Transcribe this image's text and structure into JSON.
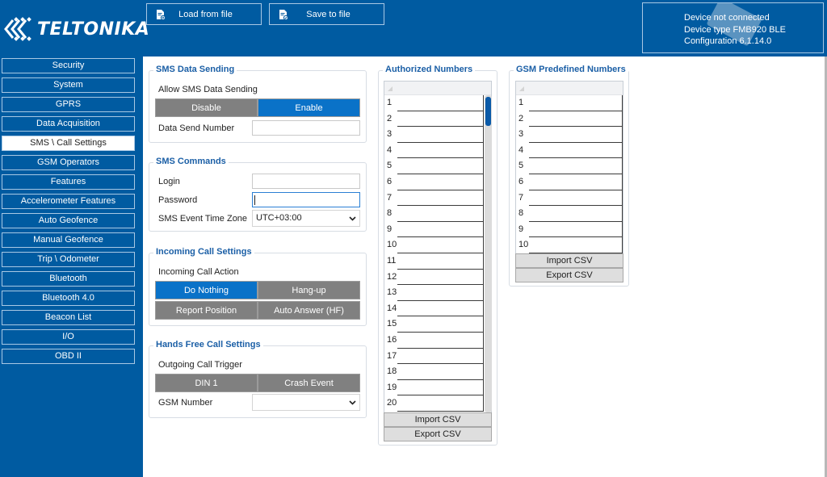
{
  "header": {
    "brand": "TELTONIKA",
    "load_button": "Load from file",
    "save_button": "Save to file",
    "device_status": "Device not connected",
    "device_type": "Device type  FMB920 BLE",
    "configuration": "Configuration  6.1.14.0"
  },
  "sidebar": {
    "active_index": 4,
    "items": [
      {
        "label": "Security"
      },
      {
        "label": "System"
      },
      {
        "label": "GPRS"
      },
      {
        "label": "Data Acquisition"
      },
      {
        "label": "SMS \\ Call Settings"
      },
      {
        "label": "GSM Operators"
      },
      {
        "label": "Features"
      },
      {
        "label": "Accelerometer Features"
      },
      {
        "label": "Auto Geofence"
      },
      {
        "label": "Manual Geofence"
      },
      {
        "label": "Trip \\ Odometer"
      },
      {
        "label": "Bluetooth"
      },
      {
        "label": "Bluetooth 4.0"
      },
      {
        "label": "Beacon List"
      },
      {
        "label": "I/O"
      },
      {
        "label": "OBD II"
      }
    ]
  },
  "sms_data_sending": {
    "title": "SMS Data Sending",
    "allow_label": "Allow SMS Data Sending",
    "options": [
      "Disable",
      "Enable"
    ],
    "selected": "Enable",
    "data_send_number_label": "Data Send Number",
    "data_send_number_value": ""
  },
  "sms_commands": {
    "title": "SMS Commands",
    "login_label": "Login",
    "login_value": "",
    "password_label": "Password",
    "password_value": "",
    "timezone_label": "SMS Event Time Zone",
    "timezone_value": "UTC+03:00"
  },
  "incoming_call": {
    "title": "Incoming Call Settings",
    "action_label": "Incoming Call Action",
    "options": [
      "Do Nothing",
      "Hang-up",
      "Report Position",
      "Auto Answer (HF)"
    ],
    "selected": "Do Nothing"
  },
  "hands_free": {
    "title": "Hands Free Call Settings",
    "trigger_label": "Outgoing Call Trigger",
    "options": [
      "DIN 1",
      "Crash Event"
    ],
    "selected": null,
    "gsm_number_label": "GSM Number",
    "gsm_number_value": ""
  },
  "authorized_numbers": {
    "title": "Authorized Numbers",
    "visible_rows": [
      "1",
      "2",
      "3",
      "4",
      "5",
      "6",
      "7",
      "8",
      "9",
      "10",
      "11",
      "12",
      "13",
      "14",
      "15",
      "16",
      "17",
      "18",
      "19",
      "20"
    ],
    "import_label": "Import CSV",
    "export_label": "Export CSV"
  },
  "gsm_predefined_numbers": {
    "title": "GSM Predefined Numbers",
    "visible_rows": [
      "1",
      "2",
      "3",
      "4",
      "5",
      "6",
      "7",
      "8",
      "9",
      "10"
    ],
    "import_label": "Import CSV",
    "export_label": "Export CSV"
  },
  "colors": {
    "brand_blue": "#005ba1",
    "selected_blue": "#0a72c8",
    "unselected_gray": "#808080",
    "group_title": "#1b5fa6"
  }
}
